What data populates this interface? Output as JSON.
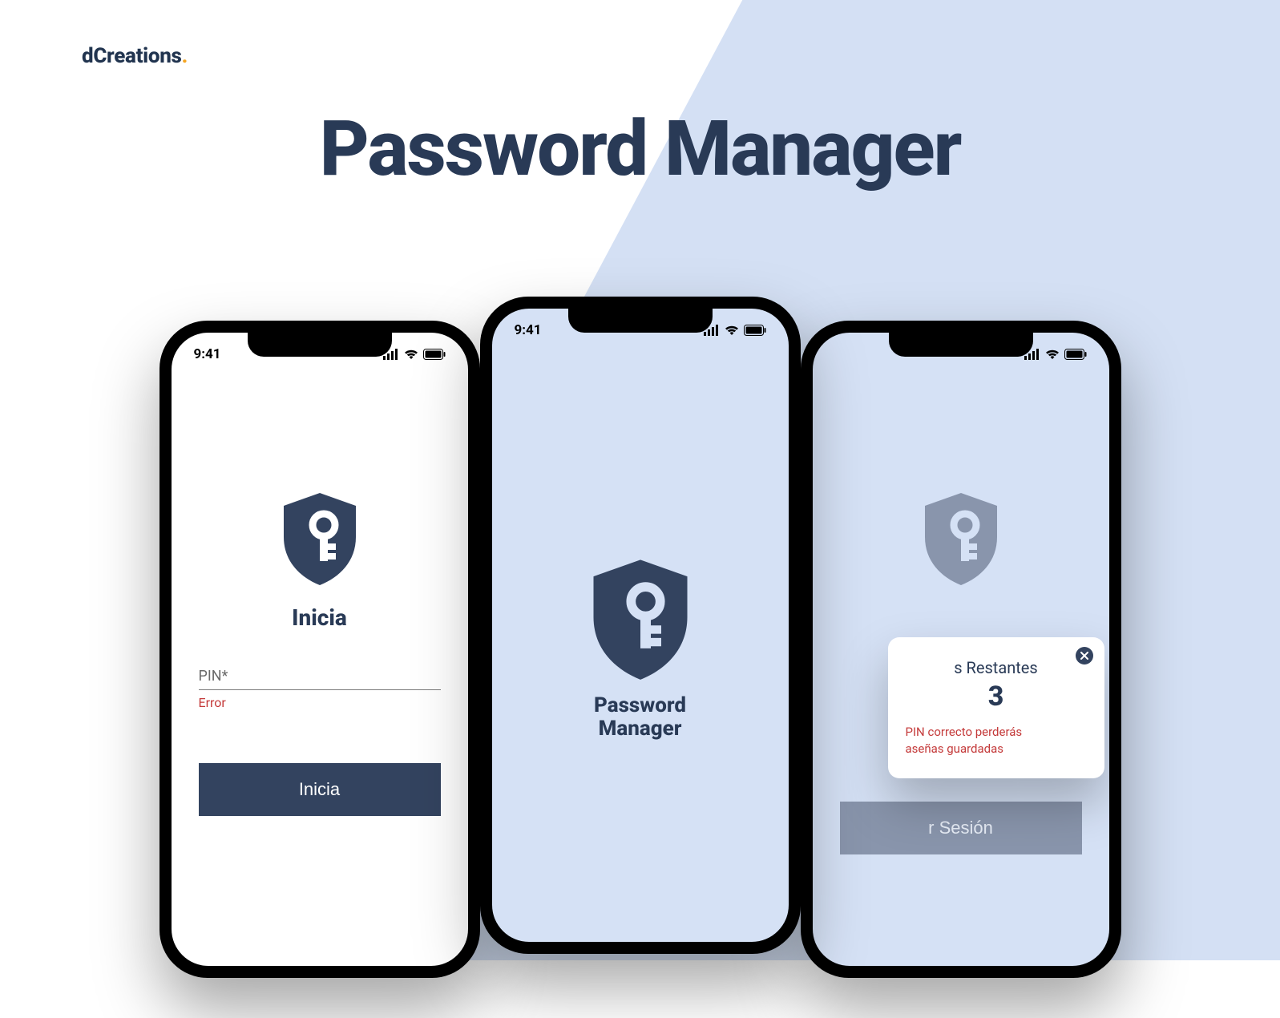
{
  "brand": {
    "name": "dCreations",
    "dot": "."
  },
  "page": {
    "title": "Password Manager"
  },
  "status": {
    "time": "9:41"
  },
  "center": {
    "app_name_line1": "Password",
    "app_name_line2": "Manager"
  },
  "left": {
    "heading_prefix": "Inicia",
    "pin_label": "PIN*",
    "error_text": "Error",
    "button_prefix": "Inicia"
  },
  "right": {
    "modal": {
      "title_suffix": "s Restantes",
      "count": "3",
      "warn_line1_suffix": "PIN correcto perderás",
      "warn_line2_suffix": "aseñas guardadas"
    },
    "button_suffix": "r Sesión"
  }
}
